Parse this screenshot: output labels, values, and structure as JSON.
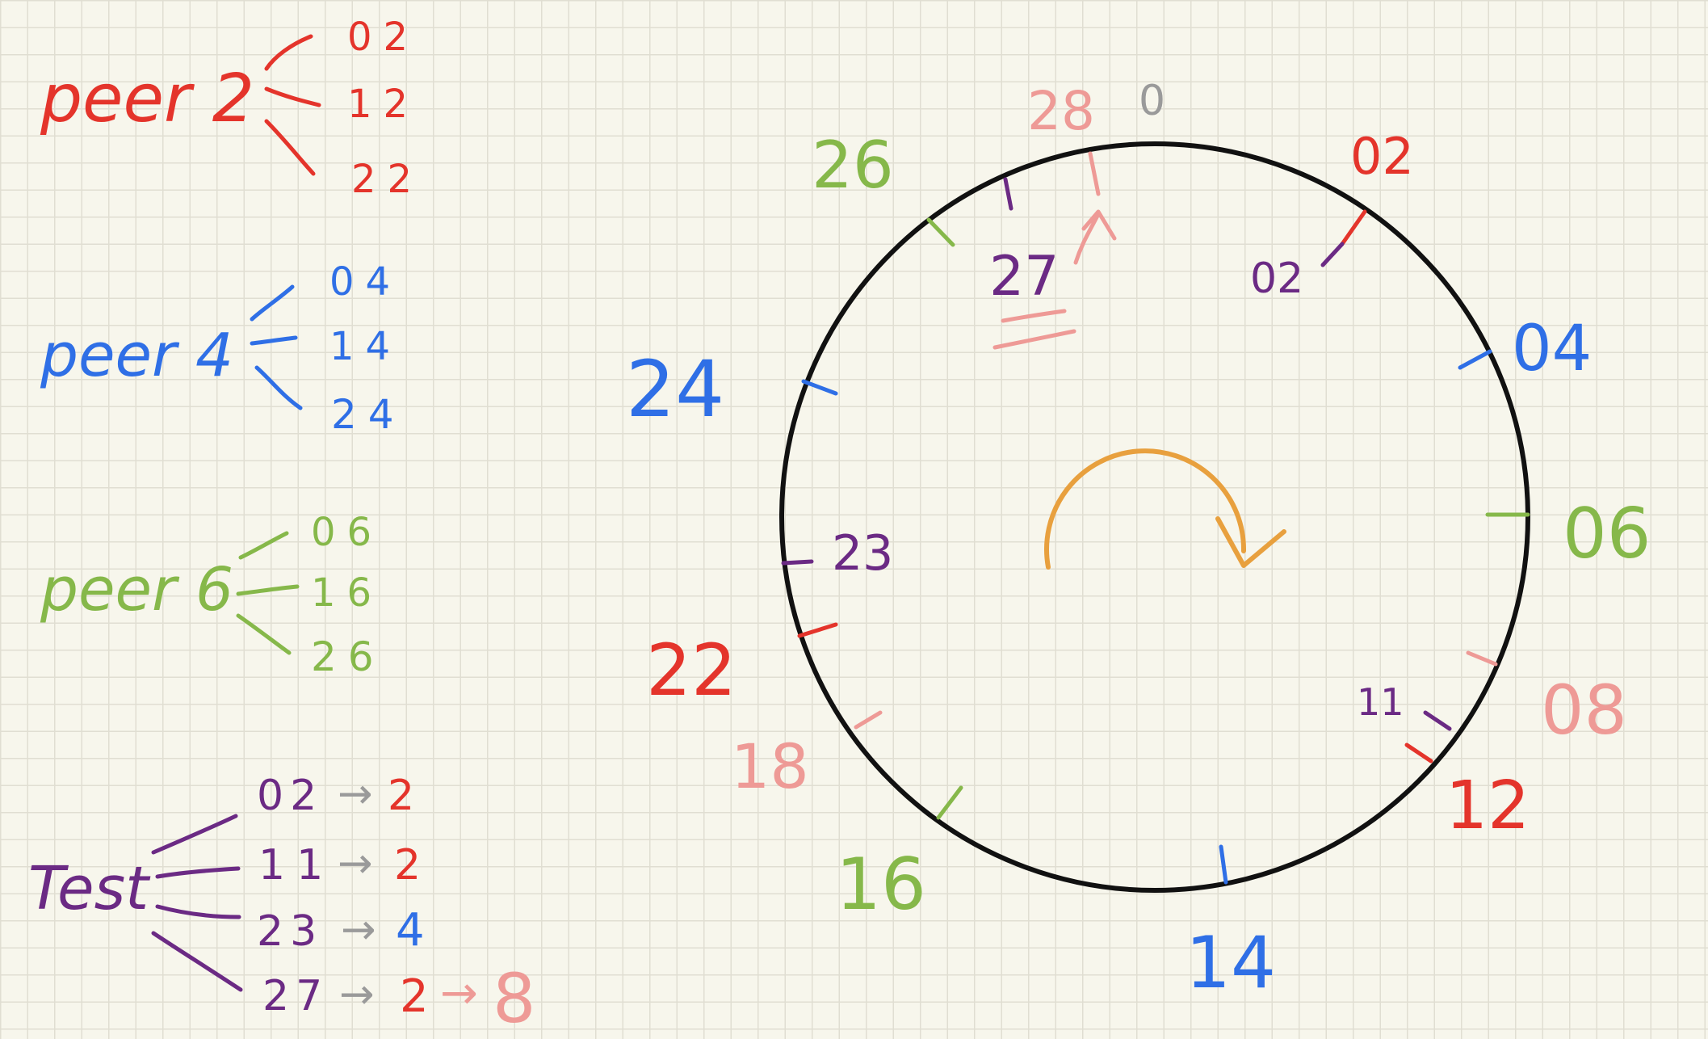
{
  "colors": {
    "red": "#e4342b",
    "blue": "#2f6fe6",
    "green": "#86b84a",
    "purple": "#6b2a84",
    "pink": "#ee9a96",
    "gray": "#9a9a9a",
    "orange": "#e8a03e",
    "black": "#111111"
  },
  "peers": [
    {
      "label": "peer 2",
      "color": "red",
      "keys": [
        "02",
        "12",
        "22"
      ]
    },
    {
      "label": "peer 4",
      "color": "blue",
      "keys": [
        "04",
        "14",
        "24"
      ]
    },
    {
      "label": "peer 6",
      "color": "green",
      "keys": [
        "06",
        "16",
        "26"
      ]
    }
  ],
  "test": {
    "label": "Test",
    "rows": [
      {
        "key": "02",
        "arrow": "→",
        "result": "2",
        "result_color": "red"
      },
      {
        "key": "11",
        "arrow": "→",
        "result": "2",
        "result_color": "red"
      },
      {
        "key": "23",
        "arrow": "→",
        "result": "4",
        "result_color": "blue"
      },
      {
        "key": "27",
        "arrow": "→",
        "result": "2",
        "result_color": "red",
        "arrow2": "→",
        "result2": "8",
        "result2_color": "pink"
      }
    ]
  },
  "ring": {
    "labels": [
      {
        "text": "0",
        "color": "gray"
      },
      {
        "text": "02",
        "color": "red"
      },
      {
        "text": "04",
        "color": "blue"
      },
      {
        "text": "06",
        "color": "green"
      },
      {
        "text": "08",
        "color": "pink"
      },
      {
        "text": "12",
        "color": "red"
      },
      {
        "text": "14",
        "color": "blue"
      },
      {
        "text": "16",
        "color": "green"
      },
      {
        "text": "18",
        "color": "pink"
      },
      {
        "text": "22",
        "color": "red"
      },
      {
        "text": "24",
        "color": "blue"
      },
      {
        "text": "26",
        "color": "green"
      },
      {
        "text": "28",
        "color": "pink"
      }
    ],
    "test_labels": [
      {
        "text": "02",
        "color": "purple"
      },
      {
        "text": "11",
        "color": "purple"
      },
      {
        "text": "23",
        "color": "purple"
      },
      {
        "text": "27",
        "color": "purple"
      }
    ],
    "rotation": "clockwise"
  }
}
